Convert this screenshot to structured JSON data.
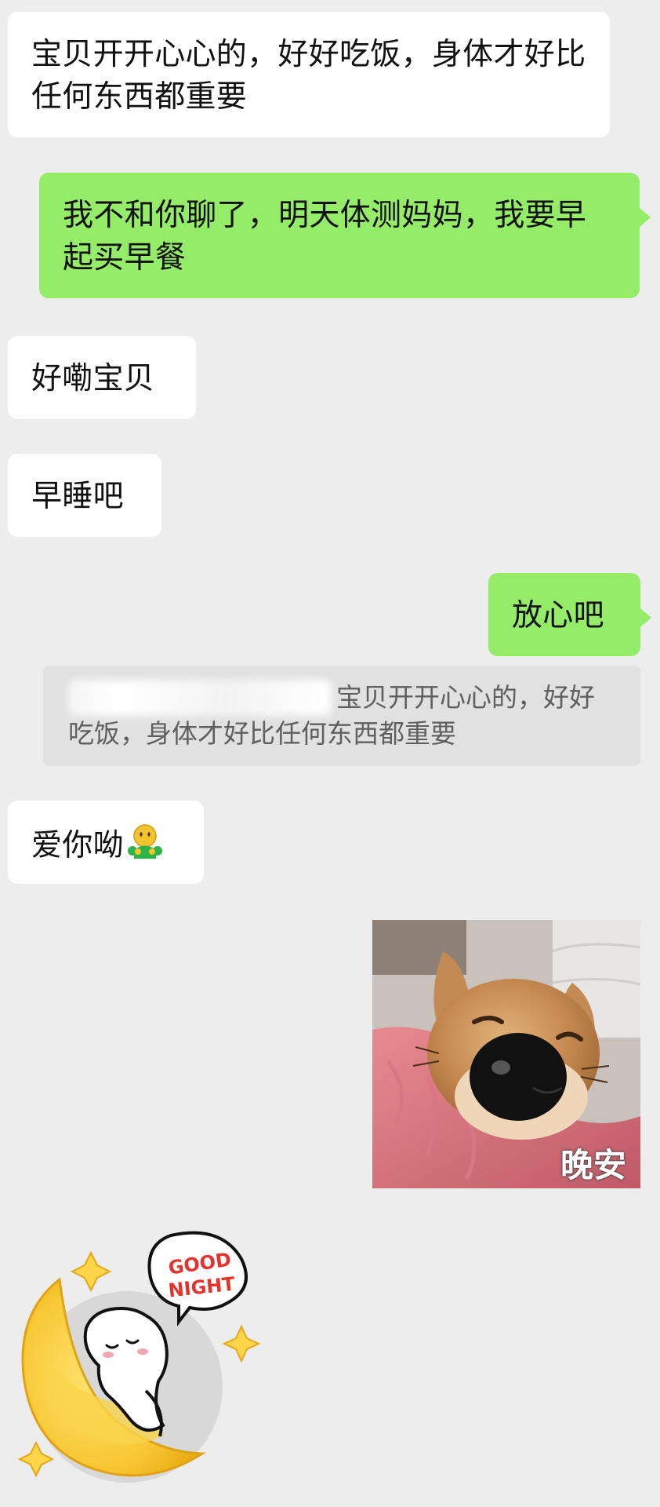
{
  "chat": {
    "messages": {
      "m1": "宝贝开开心心的，好好吃饭，身体才好比任何东西都重要",
      "m2": "我不和你聊了，明天体测妈妈，我要早起买早餐",
      "m3": "好嘞宝贝",
      "m4": "早睡吧",
      "m5": "放心吧",
      "quote_text": "宝贝开开心心的，好好吃饭，身体才好比任何东西都重要",
      "m7": "爱你呦"
    },
    "stickers": {
      "dog_caption": "晚安",
      "moon_text_line1": "GOOD",
      "moon_text_line2": "NIGHT"
    }
  },
  "colors": {
    "background": "#ededed",
    "incoming_bubble": "#ffffff",
    "outgoing_bubble": "#95ec69",
    "quote_background": "#e1e1e1"
  },
  "icons": {
    "emoji_in_message": "hug-face-emoji"
  }
}
